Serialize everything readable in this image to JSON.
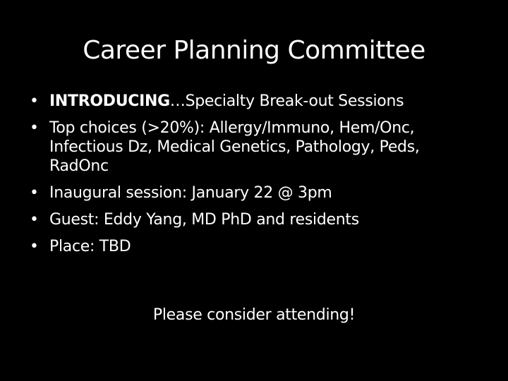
{
  "slide": {
    "title": "Career Planning Committee",
    "bullet_symbol": "•",
    "bullets": [
      {
        "strong": "INTRODUCING",
        "text": "…Specialty Break-out Sessions"
      },
      {
        "strong": "",
        "text": "Top choices (>20%): Allergy/Immuno, Hem/Onc, Infectious Dz, Medical Genetics, Pathology, Peds, RadOnc"
      },
      {
        "strong": "",
        "text": "Inaugural session: January 22 @ 3pm"
      },
      {
        "strong": "",
        "text": "Guest: Eddy Yang, MD PhD and residents"
      },
      {
        "strong": "",
        "text": "Place: TBD"
      }
    ],
    "closing": "Please consider attending!",
    "colors": {
      "background": "#000000",
      "text": "#ffffff"
    }
  }
}
